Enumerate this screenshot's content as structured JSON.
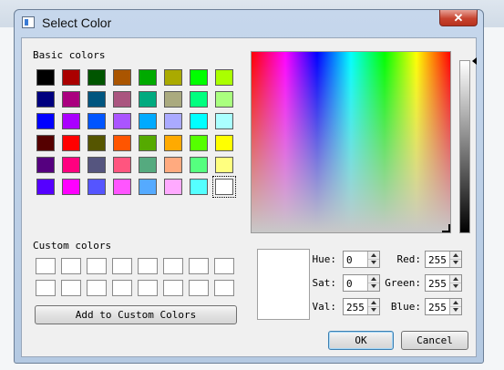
{
  "window": {
    "title": "Select Color",
    "close_glyph": "✕"
  },
  "basic_colors": {
    "label": "Basic colors",
    "selected_index": 47,
    "colors": [
      "#000000",
      "#aa0000",
      "#005500",
      "#aa5500",
      "#00aa00",
      "#aaaa00",
      "#00ff00",
      "#aaff00",
      "#00007f",
      "#aa007f",
      "#00557f",
      "#aa557f",
      "#00aa7f",
      "#aaaa7f",
      "#00ff7f",
      "#aaff7f",
      "#0000ff",
      "#aa00ff",
      "#0055ff",
      "#aa55ff",
      "#00aaff",
      "#aaaaff",
      "#00ffff",
      "#aaffff",
      "#550000",
      "#ff0000",
      "#555500",
      "#ff5500",
      "#55aa00",
      "#ffaa00",
      "#55ff00",
      "#ffff00",
      "#55007f",
      "#ff007f",
      "#55557f",
      "#ff557f",
      "#55aa7f",
      "#ffaa7f",
      "#55ff7f",
      "#ffff7f",
      "#5500ff",
      "#ff00ff",
      "#5555ff",
      "#ff55ff",
      "#55aaff",
      "#ffaaff",
      "#55ffff",
      "#ffffff"
    ]
  },
  "custom_colors": {
    "label": "Custom colors",
    "colors": [
      "#ffffff",
      "#ffffff",
      "#ffffff",
      "#ffffff",
      "#ffffff",
      "#ffffff",
      "#ffffff",
      "#ffffff",
      "#ffffff",
      "#ffffff",
      "#ffffff",
      "#ffffff",
      "#ffffff",
      "#ffffff",
      "#ffffff",
      "#ffffff"
    ]
  },
  "add_custom_button": "Add to Custom Colors",
  "current_color": "#ffffff",
  "fields": {
    "hue": {
      "label": "Hue:",
      "value": "0"
    },
    "sat": {
      "label": "Sat:",
      "value": "0"
    },
    "val": {
      "label": "Val:",
      "value": "255"
    },
    "red": {
      "label": "Red:",
      "value": "255"
    },
    "green": {
      "label": "Green:",
      "value": "255"
    },
    "blue": {
      "label": "Blue:",
      "value": "255"
    }
  },
  "buttons": {
    "ok": "OK",
    "cancel": "Cancel"
  }
}
